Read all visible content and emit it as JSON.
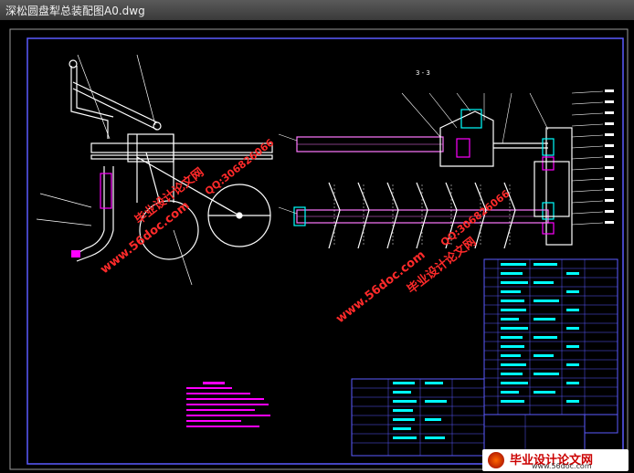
{
  "window": {
    "title": "深松圆盘犁总装配图A0.dwg"
  },
  "watermarks": {
    "url": "www.56doc.com",
    "brand": "毕业设计论文网",
    "qq": "QQ:306826066"
  },
  "drawing": {
    "section_label": "3 - 3"
  },
  "footer": {
    "brand": "毕业设计论文网",
    "url": "www.56doc.com"
  },
  "colors": {
    "background": "#000000",
    "border": "#5b5bff",
    "linework": "#ffffff",
    "accent_magenta": "#ff00ff",
    "accent_cyan": "#00ffff",
    "watermark_red": "#ff2a2a"
  }
}
